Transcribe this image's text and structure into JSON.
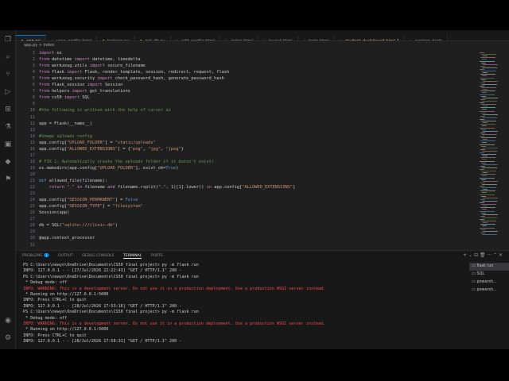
{
  "tabs": [
    {
      "label": "app.py",
      "active": true,
      "modified": false
    },
    {
      "label": "view_profile.html",
      "active": false,
      "modified": false
    },
    {
      "label": "helpers.py",
      "active": false,
      "modified": false
    },
    {
      "label": "init_db.py",
      "active": false,
      "modified": false
    },
    {
      "label": "edit_profile.html",
      "active": false,
      "modified": false
    },
    {
      "label": "index.html",
      "active": false,
      "modified": false
    },
    {
      "label": "layout.html",
      "active": false,
      "modified": false
    },
    {
      "label": "login.html",
      "active": false,
      "modified": false
    },
    {
      "label": "student_dashboard.html 1",
      "active": false,
      "modified": true
    },
    {
      "label": "patient_dash",
      "active": false,
      "modified": false
    }
  ],
  "breadcrumb": "app.py > index",
  "line_numbers": [
    "1",
    "2",
    "3",
    "4",
    "5",
    "6",
    "7",
    "8",
    "9",
    "10",
    "11",
    "12",
    "13",
    "14",
    "15",
    "16",
    "17",
    "18",
    "19",
    "20",
    "21",
    "22",
    "23",
    "24",
    "25",
    "26",
    "27",
    "28",
    "29",
    "30",
    "31"
  ],
  "code_lines": [
    "import os",
    "from datetime import datetime, timedelta",
    "from werkzeug.utils import secure_filename",
    "from flask import Flask, render_template, session, redirect, request, flash",
    "from werkzeug.security import check_password_hash, generate_password_hash",
    "from flask_session import Session",
    "from helpers import get_translations",
    "from cs50 import SQL",
    "",
    "#the following is written with the help of cursor ai",
    "",
    "app = Flask(__name__)",
    "",
    "#image uploads config",
    "app.config[\"UPLOAD_FOLDER\"] = \"static/uploads\"",
    "app.config[\"ALLOWED_EXTENSIONS\"] = {\"png\", \"jpg\", \"jpeg\"}",
    "",
    "# FIX 1: Automatically create the uploads folder if it doesn't exist!",
    "os.makedirs(app.config[\"UPLOAD_FOLDER\"], exist_ok=True)",
    "",
    "def allowed_file(filename):",
    "    return \".\" in filename and filename.rsplit(\".\", 1)[1].lower() in app.config[\"ALLOWED_EXTENSIONS\"]",
    "",
    "app.config[\"SESSION_PERMANENT\"] = False",
    "app.config[\"SESSION_TYPE\"] = \"filesystem\"",
    "Session(app)",
    "",
    "db = SQL(\"sqlite:///clinic.db\")",
    "",
    "@app.context_processor",
    ""
  ],
  "panel": {
    "tabs": [
      "PROBLEMS",
      "OUTPUT",
      "DEBUG CONSOLE",
      "TERMINAL",
      "PORTS"
    ],
    "problems_badge": "1",
    "toolbar": "+ ⌄ ⊟ 🗑 ··· ⌃ ✕"
  },
  "terminal_lines": [
    {
      "text": "PS C:\\Users\\newyo\\OneDrive\\Documents\\CS50 final project> py -m flask run",
      "warn": false
    },
    {
      "text": "INFO: 127.0.0.1 - - [27/Jul/2026 22:22:43] \"GET / HTTP/1.1\" 200 -",
      "warn": false
    },
    {
      "text": "PS C:\\Users\\newyo\\OneDrive\\Documents\\CS50 final project> py -m flask run",
      "warn": false
    },
    {
      "text": " * Debug mode: off",
      "warn": false
    },
    {
      "text": "INFO: WARNING: This is a development server. Do not use it in a production deployment. Use a production WSGI server instead.",
      "warn": true
    },
    {
      "text": " * Running on http://127.0.0.1:5000",
      "warn": false
    },
    {
      "text": "INFO: Press CTRL+C to quit",
      "warn": false
    },
    {
      "text": "INFO: 127.0.0.1 - - [28/Jul/2026 17:53:16] \"GET / HTTP/1.1\" 200 -",
      "warn": false
    },
    {
      "text": "PS C:\\Users\\newyo\\OneDrive\\Documents\\CS50 final project> py -m flask run",
      "warn": false
    },
    {
      "text": " * Debug mode: off",
      "warn": false
    },
    {
      "text": "INFO: WARNING: This is a development server. Do not use it in a production deployment. Use a production WSGI server instead.",
      "warn": true
    },
    {
      "text": " * Running on http://127.0.0.1:5000",
      "warn": false
    },
    {
      "text": "INFO: Press CTRL+C to quit",
      "warn": false
    },
    {
      "text": "INFO: 127.0.0.1 - - [28/Jul/2026 17:58:31] \"GET / HTTP/1.1\" 200 -",
      "warn": false
    }
  ],
  "terminal_list": [
    {
      "label": "flask run",
      "active": true
    },
    {
      "label": "SQL",
      "active": false
    },
    {
      "label": "powersh...",
      "active": false
    },
    {
      "label": "powersh...",
      "active": false
    }
  ],
  "colors": {
    "accent": "#0078d4",
    "warning": "#f14c4c",
    "editor_bg": "#1f1f1f"
  }
}
